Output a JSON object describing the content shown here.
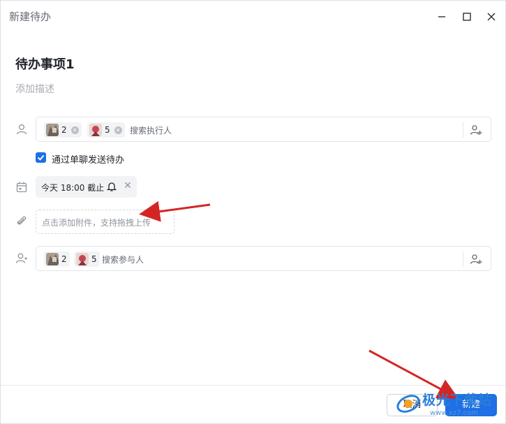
{
  "window": {
    "title": "新建待办"
  },
  "task": {
    "title": "待办事项1",
    "description_placeholder": "添加描述"
  },
  "assignees": {
    "chips": [
      {
        "label": "2"
      },
      {
        "label": "5"
      }
    ],
    "placeholder": "搜索执行人"
  },
  "notify": {
    "checked": true,
    "label": "通过单聊发送待办"
  },
  "due": {
    "text": "今天 18:00 截止"
  },
  "attachment": {
    "placeholder": "点击添加附件，支持拖拽上传"
  },
  "participants": {
    "chips": [
      {
        "label": "2"
      },
      {
        "label": "5"
      }
    ],
    "placeholder": "搜索参与人"
  },
  "footer": {
    "cancel_label": "取消",
    "create_label": "新建"
  },
  "watermark": {
    "text": "极光下载站",
    "sub": "www.xz7.com"
  },
  "colors": {
    "accent": "#1f6fe5",
    "annotation_arrow": "#d42525"
  },
  "icons": [
    "minimize-icon",
    "maximize-icon",
    "close-icon",
    "user-icon",
    "calendar-icon",
    "paperclip-icon",
    "participant-icon",
    "add-user-icon",
    "bell-icon",
    "checkmark-icon",
    "chip-remove-icon",
    "remove-icon"
  ]
}
